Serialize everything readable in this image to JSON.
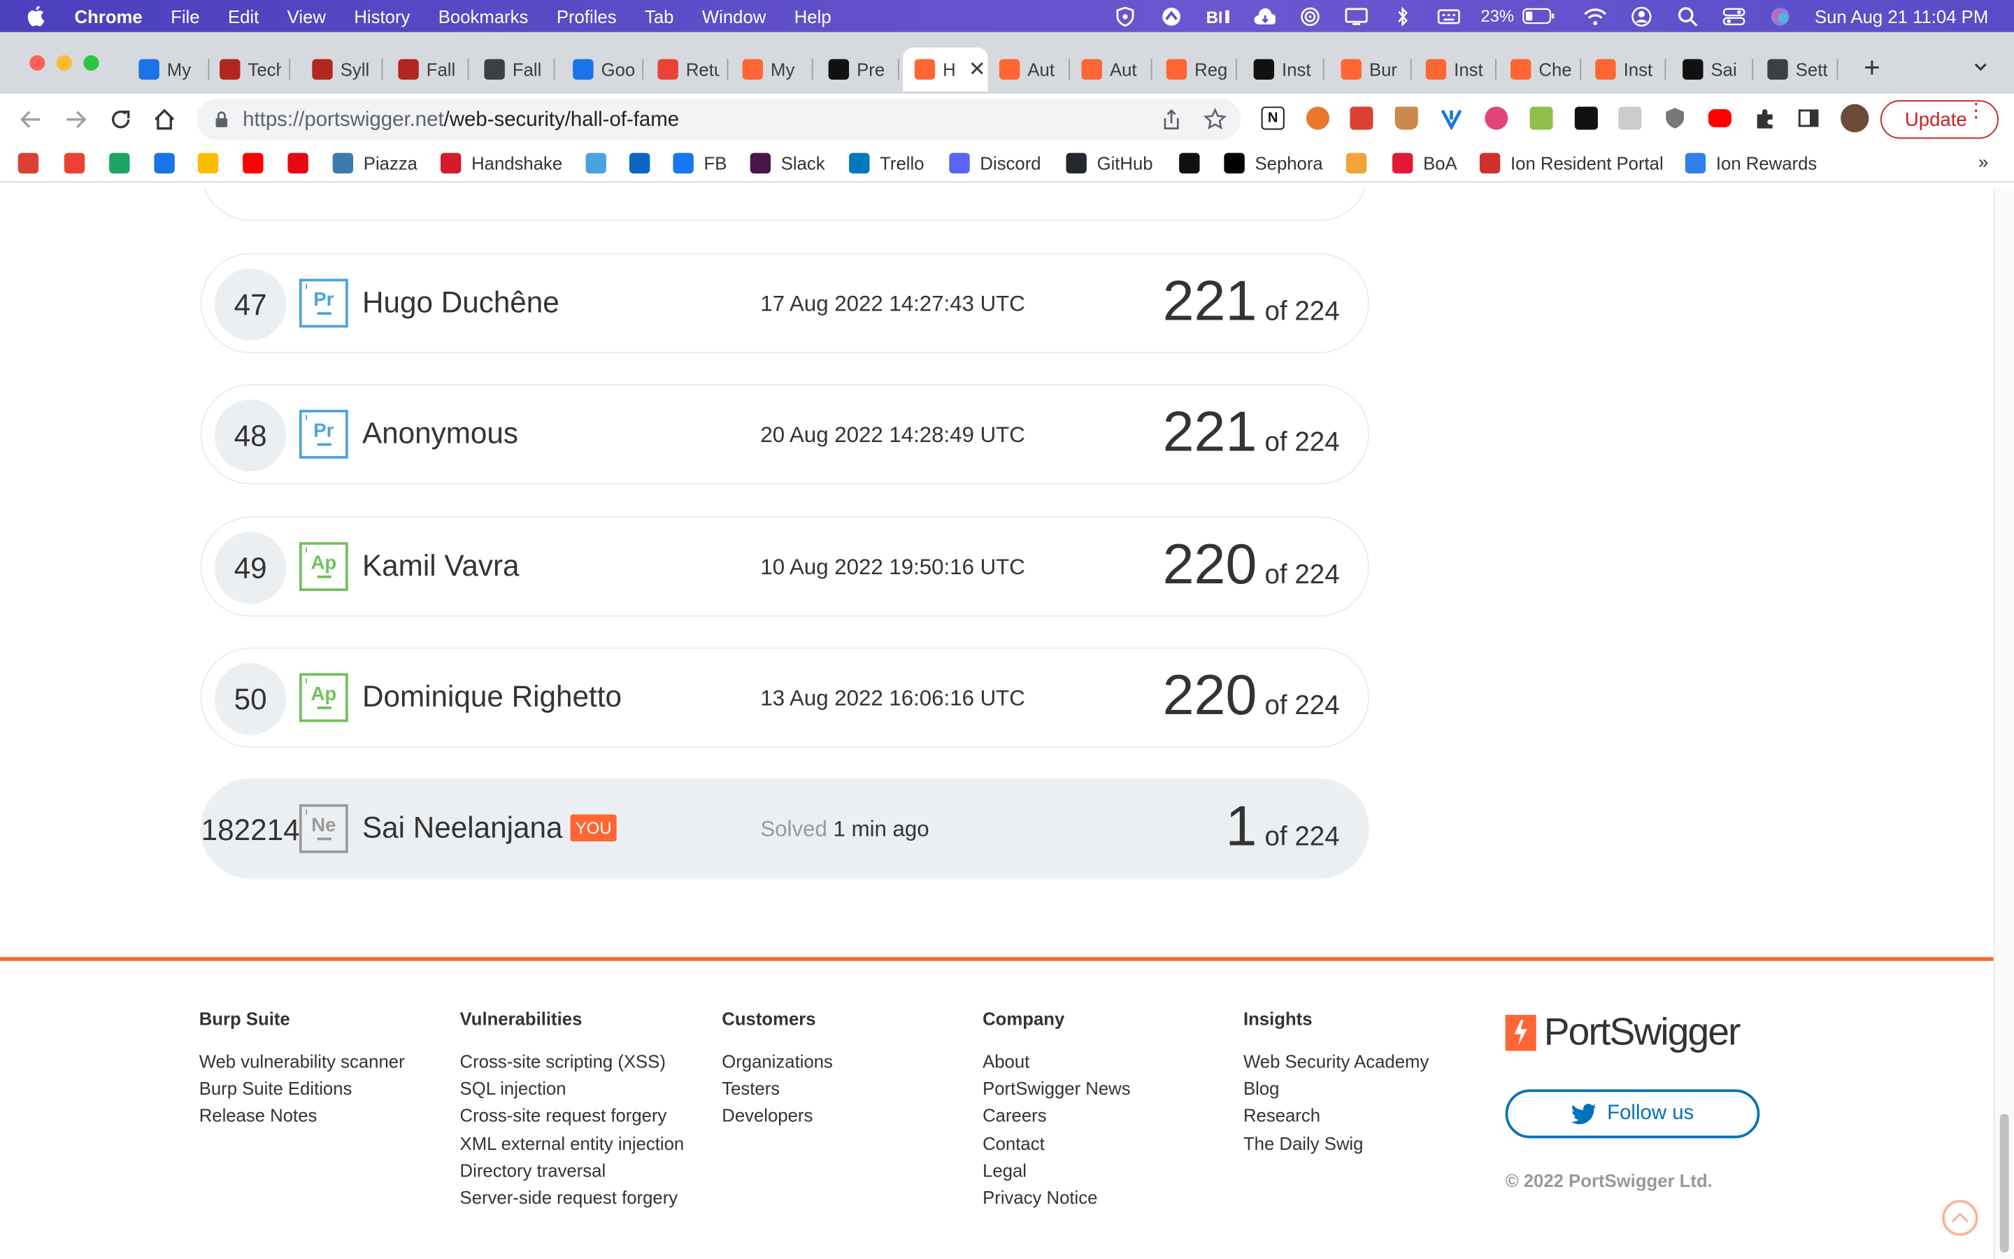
{
  "menubar": {
    "app": "Chrome",
    "items": [
      "File",
      "Edit",
      "View",
      "History",
      "Bookmarks",
      "Profiles",
      "Tab",
      "Window",
      "Help"
    ],
    "battery": "23%",
    "clock": "Sun Aug 21  11:04 PM"
  },
  "tabs": [
    {
      "label": "My",
      "icon": "google-drive-icon",
      "color": "#1a73e8"
    },
    {
      "label": "Tech",
      "icon": "canvas-icon",
      "color": "#b3261e"
    },
    {
      "label": "Syll",
      "icon": "canvas-icon",
      "color": "#b3261e"
    },
    {
      "label": "Fall",
      "icon": "canvas-icon",
      "color": "#b3261e"
    },
    {
      "label": "Fall",
      "icon": "globe-icon",
      "color": "#3c4043"
    },
    {
      "label": "Goo",
      "icon": "google-calendar-icon",
      "color": "#1a73e8"
    },
    {
      "label": "Retu",
      "icon": "gmail-icon",
      "color": "#ea4335"
    },
    {
      "label": "My",
      "icon": "portswigger-icon",
      "color": "#ff6633"
    },
    {
      "label": "Pre",
      "icon": "chegg-icon",
      "color": "#111111"
    },
    {
      "label": "H",
      "icon": "portswigger-icon",
      "color": "#ff6633",
      "active": true
    },
    {
      "label": "Aut",
      "icon": "portswigger-icon",
      "color": "#ff6633"
    },
    {
      "label": "Aut",
      "icon": "portswigger-icon",
      "color": "#ff6633"
    },
    {
      "label": "Reg",
      "icon": "portswigger-icon",
      "color": "#ff6633"
    },
    {
      "label": "Inst",
      "icon": "chegg-icon",
      "color": "#111111"
    },
    {
      "label": "Bur",
      "icon": "portswigger-icon",
      "color": "#ff6633"
    },
    {
      "label": "Inst",
      "icon": "portswigger-icon",
      "color": "#ff6633"
    },
    {
      "label": "Che",
      "icon": "portswigger-icon",
      "color": "#ff6633"
    },
    {
      "label": "Inst",
      "icon": "portswigger-icon",
      "color": "#ff6633"
    },
    {
      "label": "Sai",
      "icon": "chegg-icon",
      "color": "#111111"
    },
    {
      "label": "Sett",
      "icon": "gear-icon",
      "color": "#3c4043"
    }
  ],
  "toolbar": {
    "url_host": "https://portswigger.net",
    "url_path": "/web-security/hall-of-fame",
    "update_label": "Update"
  },
  "bookmarks": [
    {
      "label": "",
      "icon": "todoist-icon",
      "color": "#db4035"
    },
    {
      "label": "",
      "icon": "gmail-icon",
      "color": "#ea4335"
    },
    {
      "label": "",
      "icon": "google-drive-icon",
      "color": "#1fa463"
    },
    {
      "label": "",
      "icon": "google-calendar-icon",
      "color": "#1a73e8"
    },
    {
      "label": "",
      "icon": "google-photos-icon",
      "color": "#fbbc04"
    },
    {
      "label": "",
      "icon": "youtube-icon",
      "color": "#ff0000"
    },
    {
      "label": "",
      "icon": "netflix-icon",
      "color": "#e50914"
    },
    {
      "label": "Piazza",
      "icon": "piazza-icon",
      "color": "#3e7aab"
    },
    {
      "label": "Handshake",
      "icon": "handshake-icon",
      "color": "#d41b2c"
    },
    {
      "label": "",
      "icon": "mascot-icon",
      "color": "#4aa3df"
    },
    {
      "label": "",
      "icon": "linkedin-icon",
      "color": "#0a66c2"
    },
    {
      "label": "FB",
      "icon": "facebook-icon",
      "color": "#1877f2"
    },
    {
      "label": "Slack",
      "icon": "slack-icon",
      "color": "#4a154b"
    },
    {
      "label": "Trello",
      "icon": "trello-icon",
      "color": "#0079bf"
    },
    {
      "label": "Discord",
      "icon": "discord-icon",
      "color": "#5865f2"
    },
    {
      "label": "GitHub",
      "icon": "github-icon",
      "color": "#24292f"
    },
    {
      "label": "",
      "icon": "amazon-icon",
      "color": "#111111"
    },
    {
      "label": "Sephora",
      "icon": "sephora-icon",
      "color": "#000000"
    },
    {
      "label": "",
      "icon": "u-icon",
      "color": "#f3a33a"
    },
    {
      "label": "BoA",
      "icon": "boa-icon",
      "color": "#e31837"
    },
    {
      "label": "Ion Resident Portal",
      "icon": "rp-icon",
      "color": "#d0312d"
    },
    {
      "label": "Ion Rewards",
      "icon": "cr-icon",
      "color": "#2f80ed"
    }
  ],
  "leaderboard": [
    {
      "rank": "47",
      "badge": "Pr",
      "badge_color": "#4aa3df",
      "name": "Hugo Duchêne",
      "date": "17 Aug 2022 14:27:43 UTC",
      "score": "221",
      "of": "of 224"
    },
    {
      "rank": "48",
      "badge": "Pr",
      "badge_color": "#4aa3df",
      "name": "Anonymous",
      "date": "20 Aug 2022 14:28:49 UTC",
      "score": "221",
      "of": "of 224"
    },
    {
      "rank": "49",
      "badge": "Ap",
      "badge_color": "#70c05a",
      "name": "Kamil Vavra",
      "date": "10 Aug 2022 19:50:16 UTC",
      "score": "220",
      "of": "of 224"
    },
    {
      "rank": "50",
      "badge": "Ap",
      "badge_color": "#70c05a",
      "name": "Dominique Righetto",
      "date": "13 Aug 2022 16:06:16 UTC",
      "score": "220",
      "of": "of 224"
    }
  ],
  "you_row": {
    "rank": "182214",
    "badge": "Ne",
    "badge_color": "#999999",
    "name": "Sai Neelanjana",
    "you_tag": "YOU",
    "solved_label": "Solved",
    "solved_time": "1 min ago",
    "score": "1",
    "of": "of 224"
  },
  "footer": {
    "columns": [
      {
        "heading": "Burp Suite",
        "links": [
          "Web vulnerability scanner",
          "Burp Suite Editions",
          "Release Notes"
        ]
      },
      {
        "heading": "Vulnerabilities",
        "links": [
          "Cross-site scripting (XSS)",
          "SQL injection",
          "Cross-site request forgery",
          "XML external entity injection",
          "Directory traversal",
          "Server-side request forgery"
        ]
      },
      {
        "heading": "Customers",
        "links": [
          "Organizations",
          "Testers",
          "Developers"
        ]
      },
      {
        "heading": "Company",
        "links": [
          "About",
          "PortSwigger News",
          "Careers",
          "Contact",
          "Legal",
          "Privacy Notice"
        ]
      },
      {
        "heading": "Insights",
        "links": [
          "Web Security Academy",
          "Blog",
          "Research",
          "The Daily Swig"
        ]
      }
    ],
    "brand": "PortSwigger",
    "follow_label": "Follow us",
    "copyright": "© 2022 PortSwigger Ltd."
  },
  "colors": {
    "accent": "#ff6633",
    "twitter": "#0071bc",
    "text": "#333333"
  }
}
